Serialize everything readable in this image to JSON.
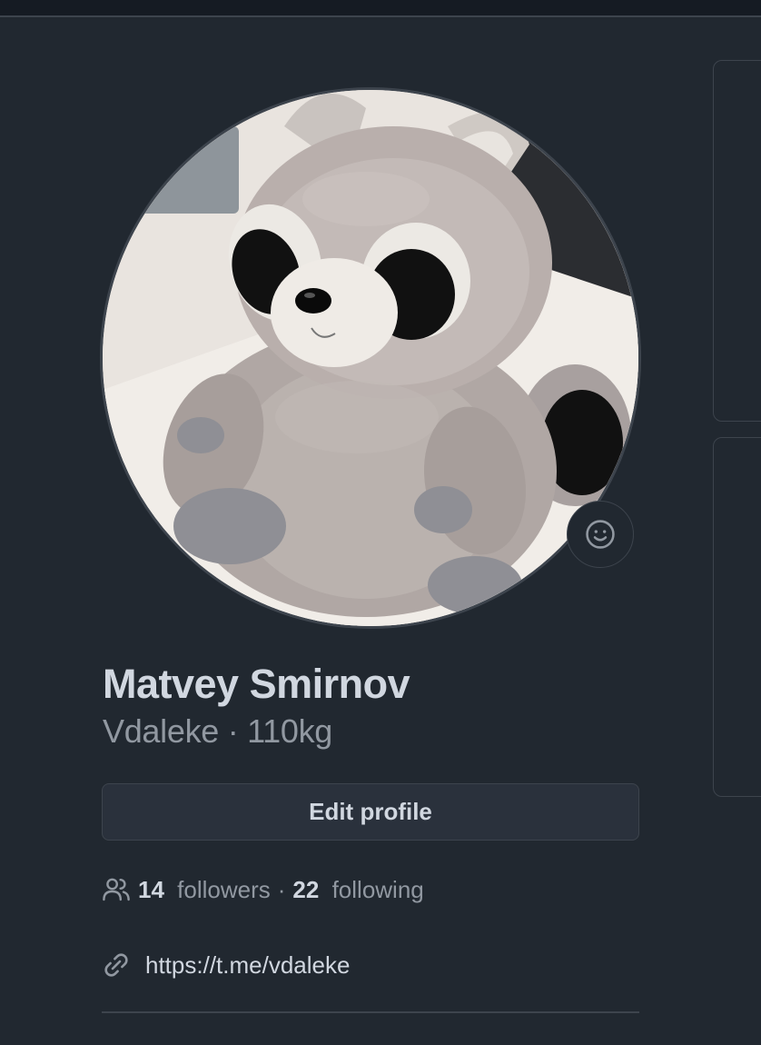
{
  "profile": {
    "avatar_alt": "plush raccoon toy avatar",
    "name": "Matvey Smirnov",
    "username": "Vdaleke",
    "separator": "·",
    "pronouns": "110kg",
    "edit_label": "Edit profile",
    "followers_count": "14",
    "followers_label": "followers",
    "following_count": "22",
    "following_label": "following",
    "link_url": "https://t.me/vdaleke"
  },
  "icons": {
    "set_status": "smiley-icon",
    "people": "people-icon",
    "link": "link-icon"
  },
  "colors": {
    "background": "#212830",
    "text_primary": "#d1d7e0",
    "text_muted": "#9198a1",
    "border": "#3d444d",
    "button_bg": "#2a313c"
  }
}
